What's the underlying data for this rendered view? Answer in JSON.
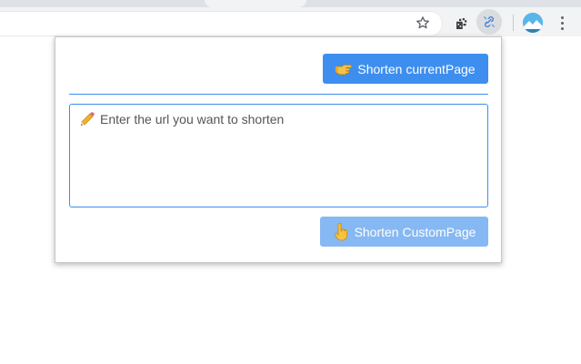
{
  "browser": {
    "toolbar_icons": [
      "star-icon",
      "extension-puzzle-icon",
      "link-shortener-icon",
      "profile-avatar",
      "more-menu-icon"
    ]
  },
  "popup": {
    "current_button": {
      "icon": "pointing-right-hand",
      "label": "Shorten currentPage"
    },
    "url_input": {
      "icon": "pencil",
      "placeholder": "Enter the url you want to shorten",
      "value": ""
    },
    "custom_button": {
      "icon": "pointing-up-hand",
      "label": "Shorten CustomPage"
    }
  },
  "colors": {
    "primary": "#3d8eef",
    "primary_disabled": "#86b8f3",
    "toolbar_bg": "#f1f3f4"
  }
}
